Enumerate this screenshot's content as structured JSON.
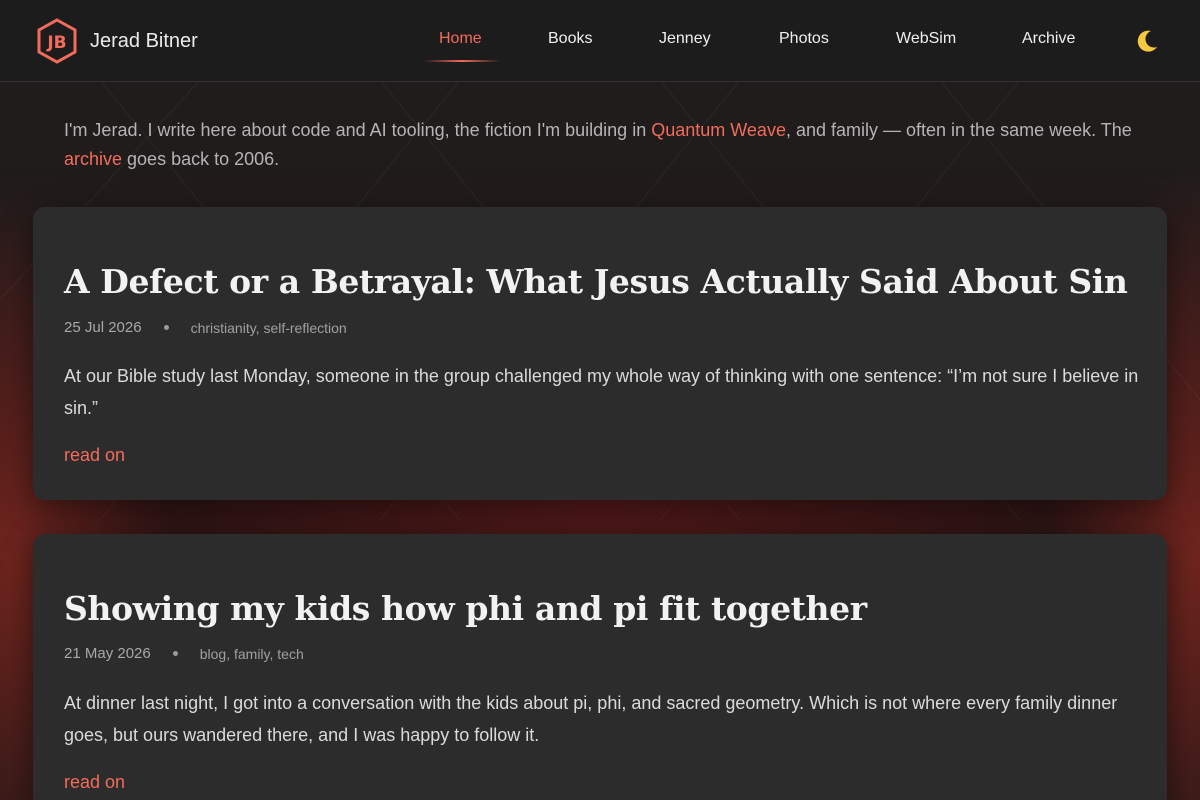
{
  "site": {
    "logo_initials": "JB",
    "name": "Jerad Bitner"
  },
  "nav": {
    "items": [
      {
        "label": "Home",
        "active": true
      },
      {
        "label": "Books",
        "active": false
      },
      {
        "label": "Jenney",
        "active": false
      },
      {
        "label": "Photos",
        "active": false
      },
      {
        "label": "WebSim",
        "active": false
      },
      {
        "label": "Archive",
        "active": false
      }
    ],
    "theme_toggle_icon": "moon-icon"
  },
  "intro": {
    "part1": "I'm Jerad. I write here about code and AI tooling, the fiction I'm building in ",
    "link1": "Quantum Weave",
    "part2": ", and family — often in the same week. The ",
    "link2": "archive",
    "part3": " goes back to 2006."
  },
  "posts": [
    {
      "title": "A Defect or a Betrayal: What Jesus Actually Said About Sin",
      "date": "25 Jul 2026",
      "tags": "christianity, self-reflection",
      "excerpt": "At our Bible study last Monday, someone in the group challenged my whole way of thinking with one sentence: “I’m not sure I believe in sin.”",
      "read_on": "read on"
    },
    {
      "title": "Showing my kids how phi and pi fit together",
      "date": "21 May 2026",
      "tags": "blog, family, tech",
      "excerpt": "At dinner last night, I got into a conversation with the kids about pi, phi, and sacred geometry. Which is not where every family dinner goes, but ours wandered there, and I was happy to follow it.",
      "read_on": "read on"
    }
  ],
  "colors": {
    "accent": "#f26b5b",
    "background": "#1b1b1b",
    "card": "#2c2c2c",
    "moon": "#f5c842"
  }
}
